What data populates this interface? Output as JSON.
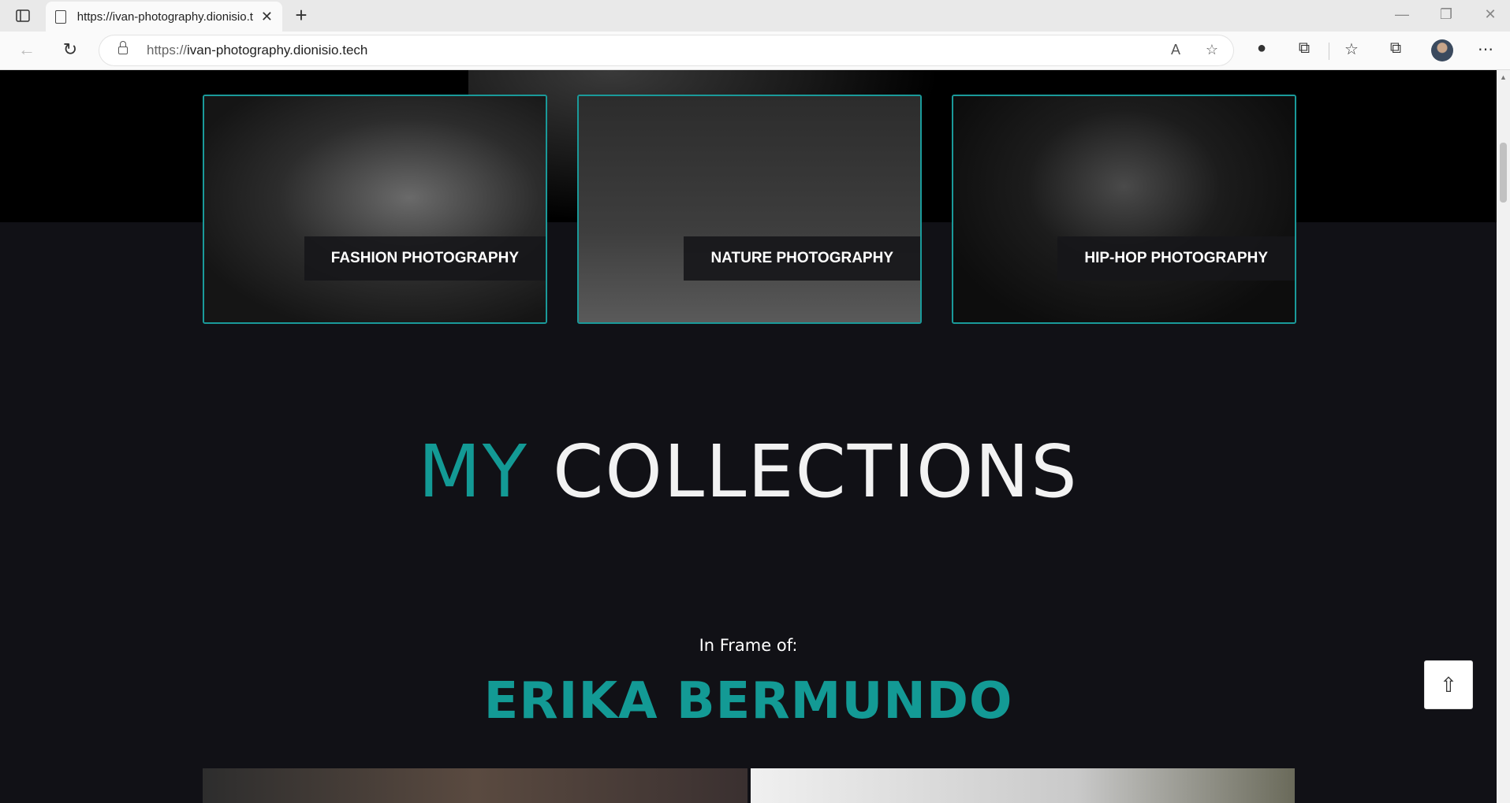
{
  "browser": {
    "tab_title": "https://ivan-photography.dionisio.tech",
    "url_protocol": "https://",
    "url_host": "ivan-photography.dionisio.tech"
  },
  "cards": [
    {
      "label": "FASHION PHOTOGRAPHY"
    },
    {
      "label": "NATURE PHOTOGRAPHY"
    },
    {
      "label": "HIP-HOP PHOTOGRAPHY"
    }
  ],
  "collections": {
    "title_accent": "MY",
    "title_rest": "COLLECTIONS",
    "frame_label": "In Frame of:",
    "frame_name": "ERIKA BERMUNDO"
  },
  "colors": {
    "accent": "#139a95",
    "background": "#111116"
  }
}
